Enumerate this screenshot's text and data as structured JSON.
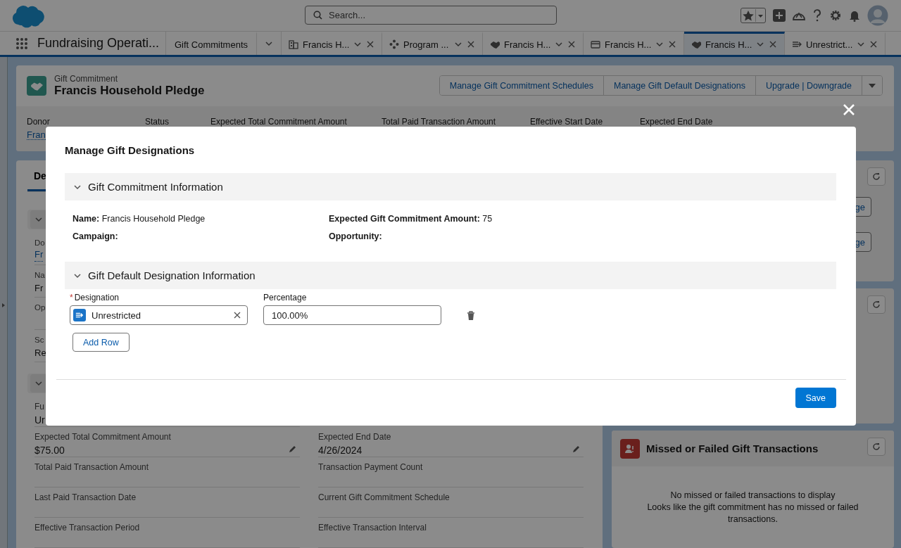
{
  "global_header": {
    "search": {
      "placeholder": "Search..."
    }
  },
  "nav": {
    "app_name": "Fundraising Operati...",
    "tabs": [
      {
        "label": "Gift Commitments",
        "kind": "home",
        "selected": false
      },
      {
        "label": "Francis H...",
        "kind": "account",
        "selected": false
      },
      {
        "label": "Program ...",
        "kind": "program",
        "selected": false
      },
      {
        "label": "Francis H...",
        "kind": "commitment",
        "selected": false
      },
      {
        "label": "Francis H...",
        "kind": "payment",
        "selected": false
      },
      {
        "label": "Francis H...",
        "kind": "commitment",
        "selected": true
      },
      {
        "label": "Unrestrict...",
        "kind": "designation",
        "selected": false
      }
    ]
  },
  "record": {
    "type_label": "Gift Commitment",
    "title": "Francis Household Pledge",
    "actions": [
      "Manage Gift Commitment Schedules",
      "Manage Gift Default Designations",
      "Upgrade | Downgrade"
    ],
    "highlights": [
      {
        "label": "Donor",
        "value": "Fran"
      },
      {
        "label": "Status"
      },
      {
        "label": "Expected Total Commitment Amount"
      },
      {
        "label": "Total Paid Transaction Amount"
      },
      {
        "label": "Effective Start Date"
      },
      {
        "label": "Expected End Date"
      }
    ]
  },
  "detail": {
    "tabs": [
      {
        "label": "De",
        "selected": true
      }
    ],
    "sections": [
      {
        "expanded": true,
        "rows": [
          [
            {
              "label": "Do",
              "value": "Fr",
              "link": true
            }
          ],
          [
            {
              "label": "Na",
              "value": "Fr"
            }
          ],
          [
            {
              "label": "Op"
            }
          ],
          [
            {
              "label": "Sc",
              "value": "Re"
            }
          ]
        ]
      },
      {
        "expanded": true,
        "rows": [
          [
            {
              "label": "Fu",
              "value": "Ur"
            }
          ],
          [
            {
              "label": "Expected Total Commitment Amount",
              "value": "$75.00",
              "editable": true
            },
            {
              "label": "Expected End Date",
              "value": "4/26/2024",
              "editable": true
            }
          ],
          [
            {
              "label": "Total Paid Transaction Amount"
            },
            {
              "label": "Transaction Payment Count"
            }
          ],
          [
            {
              "label": "Last Paid Transaction Date"
            },
            {
              "label": "Current Gift Commitment Schedule"
            }
          ],
          [
            {
              "label": "Effective Transaction Period"
            },
            {
              "label": "Effective Transaction Interval"
            }
          ]
        ]
      }
    ]
  },
  "side_cards": [
    {
      "kind": "actions",
      "buttons": [
        "ge",
        "ge"
      ]
    },
    {
      "kind": "blank"
    },
    {
      "kind": "list",
      "title": "Missed or Failed Gift Transactions",
      "messages": [
        "No missed or failed transactions to display",
        "Looks like the gift commitment has no missed or failed transactions."
      ]
    }
  ],
  "modal": {
    "title": "Manage Gift Designations",
    "sections": [
      {
        "kind": "info",
        "title": "Gift Commitment Information",
        "expanded": true,
        "fields": [
          {
            "label": "Name:",
            "value": "Francis Household Pledge"
          },
          {
            "label": "Expected Gift Commitment Amount:",
            "value": "75"
          },
          {
            "label": "Campaign:"
          },
          {
            "label": "Opportunity:"
          }
        ]
      },
      {
        "kind": "designations",
        "title": "Gift Default Designation Information",
        "expanded": true,
        "designation_label": "Designation",
        "required": true,
        "required_mark": "*",
        "percentage_label": "Percentage",
        "rows": [
          {
            "designation": "Unrestricted",
            "percentage": "100.00%"
          }
        ],
        "add_button": "Add Row"
      }
    ],
    "save_button": "Save"
  }
}
